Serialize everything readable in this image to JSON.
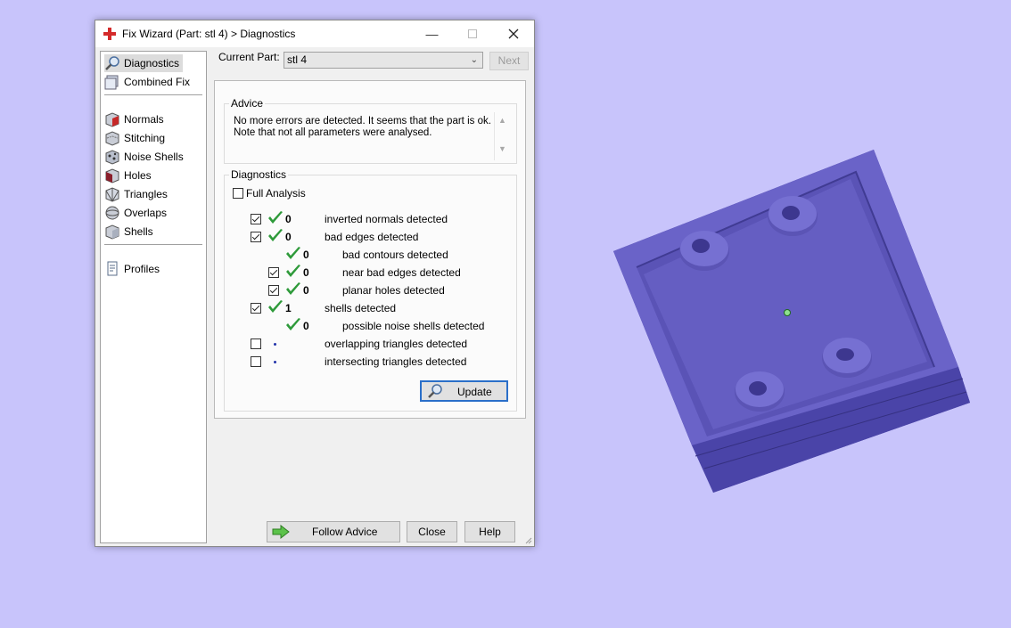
{
  "window": {
    "title": "Fix Wizard (Part: stl 4) > Diagnostics",
    "minimize_icon": "minimize-icon",
    "maximize_icon": "maximize-icon",
    "close_icon": "close-icon"
  },
  "sidebar": {
    "items": [
      {
        "label": "Diagnostics",
        "icon": "magnifier-icon",
        "selected": true
      },
      {
        "label": "Combined Fix",
        "icon": "layers-icon"
      },
      {
        "label": "Normals",
        "icon": "normals-cube-icon"
      },
      {
        "label": "Stitching",
        "icon": "stitching-cube-icon"
      },
      {
        "label": "Noise Shells",
        "icon": "noise-shells-icon"
      },
      {
        "label": "Holes",
        "icon": "holes-cube-icon"
      },
      {
        "label": "Triangles",
        "icon": "triangles-cube-icon"
      },
      {
        "label": "Overlaps",
        "icon": "overlaps-icon"
      },
      {
        "label": "Shells",
        "icon": "shells-cube-icon"
      },
      {
        "label": "Profiles",
        "icon": "document-icon"
      }
    ]
  },
  "current_part": {
    "label": "Current Part:",
    "value": "stl 4",
    "next_label": "Next"
  },
  "advice": {
    "title": "Advice",
    "line1": "No more errors are detected. It seems that the part is ok.",
    "line2": "Note that not all parameters were analysed."
  },
  "diagnostics": {
    "title": "Diagnostics",
    "full_analysis_label": "Full Analysis",
    "full_analysis_checked": false,
    "rows": [
      {
        "label": "inverted normals detected",
        "count": "0",
        "checkbox": true,
        "checked": true,
        "status": "ok",
        "indent": 0
      },
      {
        "label": "bad edges detected",
        "count": "0",
        "checkbox": true,
        "checked": true,
        "status": "ok",
        "indent": 0
      },
      {
        "label": "bad contours detected",
        "count": "0",
        "checkbox": false,
        "checked": false,
        "status": "ok",
        "indent": 1
      },
      {
        "label": "near bad edges detected",
        "count": "0",
        "checkbox": true,
        "checked": true,
        "status": "ok",
        "indent": 1
      },
      {
        "label": "planar holes detected",
        "count": "0",
        "checkbox": true,
        "checked": true,
        "status": "ok",
        "indent": 1
      },
      {
        "label": "shells detected",
        "count": "1",
        "checkbox": true,
        "checked": true,
        "status": "ok",
        "indent": 0
      },
      {
        "label": "possible noise shells detected",
        "count": "0",
        "checkbox": false,
        "checked": false,
        "status": "ok",
        "indent": 1
      },
      {
        "label": "overlapping triangles detected",
        "count": "",
        "checkbox": true,
        "checked": false,
        "status": "pending",
        "indent": 0
      },
      {
        "label": "intersecting triangles detected",
        "count": "",
        "checkbox": true,
        "checked": false,
        "status": "pending",
        "indent": 0
      }
    ],
    "update_label": "Update"
  },
  "footer": {
    "follow_advice_label": "Follow Advice",
    "close_label": "Close",
    "help_label": "Help"
  },
  "colors": {
    "viewport_background": "#c8c4fb",
    "part_color": "#5d56b8",
    "check_green": "#2e9a3a",
    "update_border": "#2a6fc9"
  }
}
